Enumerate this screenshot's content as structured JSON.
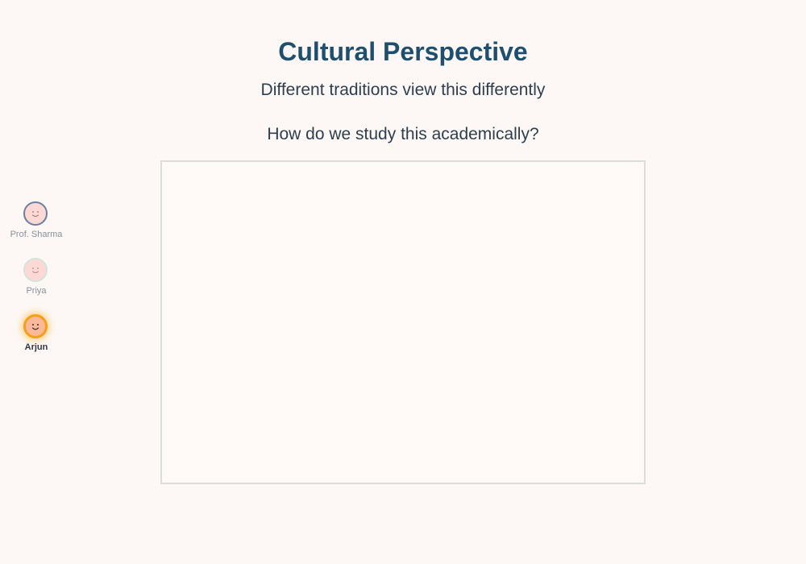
{
  "slide": {
    "title": "Cultural Perspective",
    "subtitle": "Different traditions view this differently",
    "question": "How do we study this academically?"
  },
  "speakers": [
    {
      "name": "Prof. Sharma",
      "active": false,
      "face_color": "#fcd9d4",
      "ring_color": "#6b7fa3"
    },
    {
      "name": "Priya",
      "active": false,
      "face_color": "#fcd9d4",
      "ring_color": "#d5e3dc"
    },
    {
      "name": "Arjun",
      "active": true,
      "face_color": "#f9b99a",
      "ring_color": "#f5a016"
    }
  ],
  "colors": {
    "background": "#fdf8f5",
    "title": "#1f4f6e",
    "text": "#2c3e50",
    "stage_border": "#dcdcdc",
    "active_glow": "#ffd27a"
  }
}
